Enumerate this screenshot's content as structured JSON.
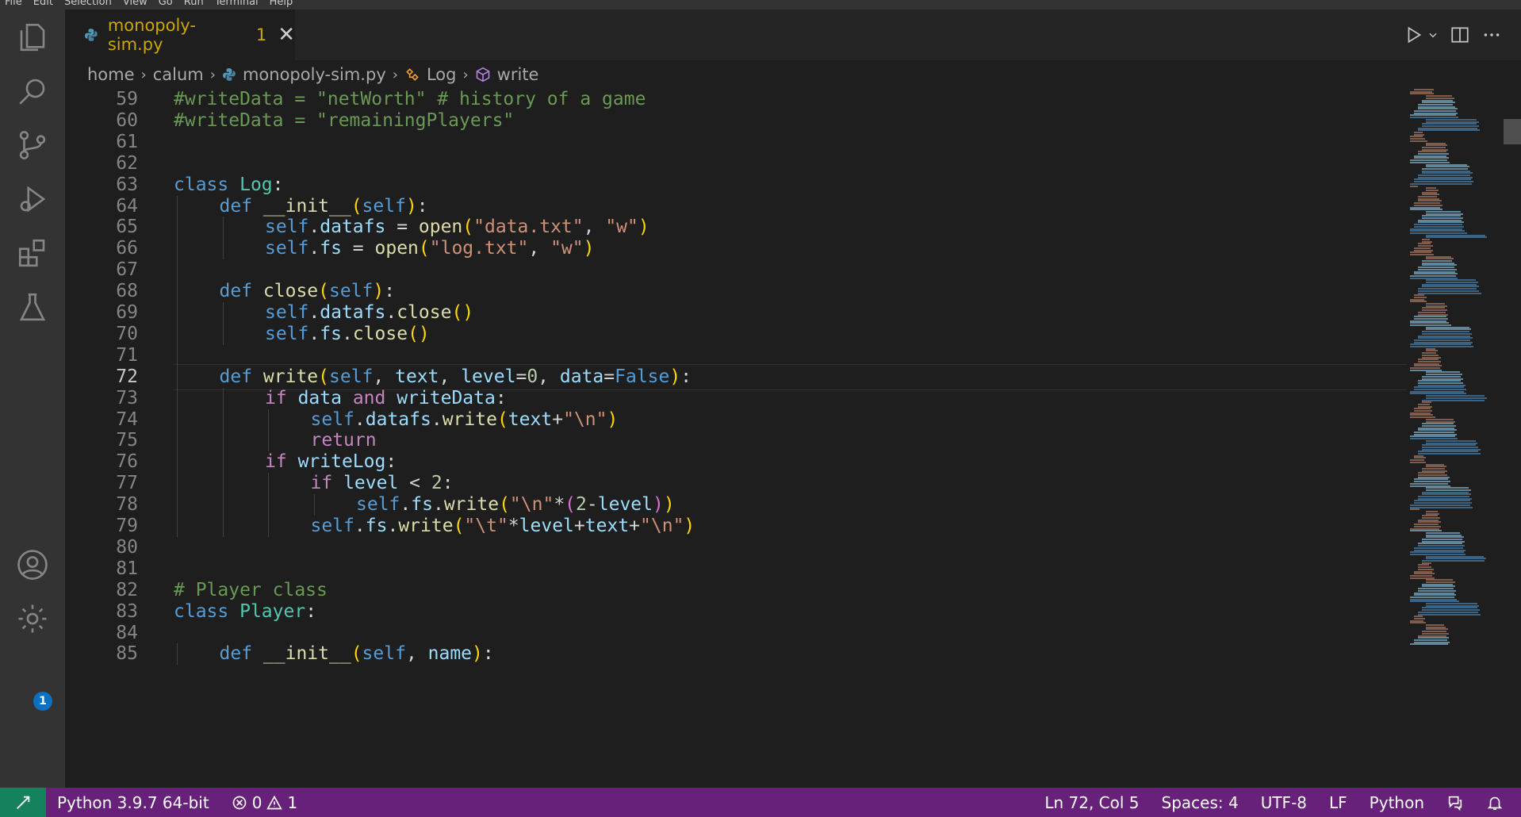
{
  "menu": [
    "File",
    "Edit",
    "Selection",
    "View",
    "Go",
    "Run",
    "Terminal",
    "Help"
  ],
  "activity_bar": {
    "items": [
      "files-icon",
      "search-icon",
      "source-control-icon",
      "run-debug-icon",
      "extensions-icon",
      "testing-icon"
    ],
    "accounts_badge": "1"
  },
  "tab": {
    "filename": "monopoly-sim.py",
    "problem_count": "1"
  },
  "breadcrumb": {
    "items": [
      "home",
      "calum",
      "monopoly-sim.py",
      "Log",
      "write"
    ]
  },
  "editor": {
    "current_line": 72,
    "lines": [
      {
        "n": "59",
        "indent": 0,
        "code": "#writeData = \"netWorth\" # history of a game"
      },
      {
        "n": "60",
        "indent": 0,
        "code": "#writeData = \"remainingPlayers\""
      },
      {
        "n": "61",
        "indent": 0,
        "code": ""
      },
      {
        "n": "62",
        "indent": 0,
        "code": ""
      },
      {
        "n": "63",
        "indent": 0,
        "code": "class Log:"
      },
      {
        "n": "64",
        "indent": 1,
        "code": "def __init__(self):"
      },
      {
        "n": "65",
        "indent": 2,
        "code": "self.datafs = open(\"data.txt\", \"w\")"
      },
      {
        "n": "66",
        "indent": 2,
        "code": "self.fs = open(\"log.txt\", \"w\")"
      },
      {
        "n": "67",
        "indent": 0,
        "code": ""
      },
      {
        "n": "68",
        "indent": 1,
        "code": "def close(self):"
      },
      {
        "n": "69",
        "indent": 2,
        "code": "self.datafs.close()"
      },
      {
        "n": "70",
        "indent": 2,
        "code": "self.fs.close()"
      },
      {
        "n": "71",
        "indent": 0,
        "code": ""
      },
      {
        "n": "72",
        "indent": 1,
        "code": "def write(self, text, level=0, data=False):"
      },
      {
        "n": "73",
        "indent": 2,
        "code": "if data and writeData:"
      },
      {
        "n": "74",
        "indent": 3,
        "code": "self.datafs.write(text+\"\\n\")"
      },
      {
        "n": "75",
        "indent": 3,
        "code": "return"
      },
      {
        "n": "76",
        "indent": 2,
        "code": "if writeLog:"
      },
      {
        "n": "77",
        "indent": 3,
        "code": "if level < 2:"
      },
      {
        "n": "78",
        "indent": 4,
        "code": "self.fs.write(\"\\n\"*(2-level))"
      },
      {
        "n": "79",
        "indent": 3,
        "code": "self.fs.write(\"\\t\"*level+text+\"\\n\")"
      },
      {
        "n": "80",
        "indent": 0,
        "code": ""
      },
      {
        "n": "81",
        "indent": 0,
        "code": ""
      },
      {
        "n": "82",
        "indent": 0,
        "code": "# Player class"
      },
      {
        "n": "83",
        "indent": 0,
        "code": "class Player:"
      },
      {
        "n": "84",
        "indent": 0,
        "code": ""
      },
      {
        "n": "85",
        "indent": 1,
        "code": "def __init__(self, name):"
      }
    ]
  },
  "status_bar": {
    "interpreter": "Python 3.9.7 64-bit",
    "errors": "0",
    "warnings": "1",
    "cursor": "Ln 72, Col 5",
    "spaces": "Spaces: 4",
    "encoding": "UTF-8",
    "eol": "LF",
    "language": "Python"
  }
}
